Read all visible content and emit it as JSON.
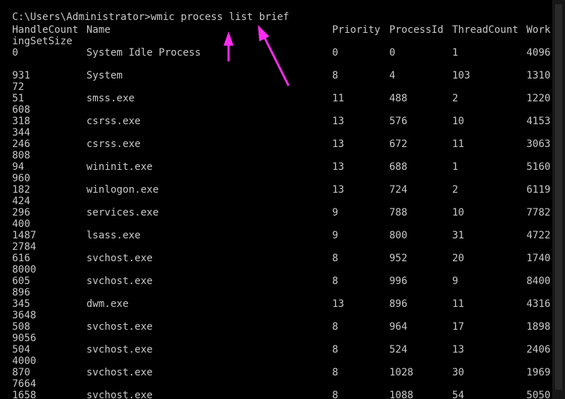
{
  "console": {
    "prompt": "C:\\Users\\Administrator>",
    "command": "wmic process list brief",
    "headers": {
      "handle": "HandleCount",
      "name": "Name",
      "priority": "Priority",
      "pid": "ProcessId",
      "threads": "ThreadCount",
      "work": "Work",
      "work_wrap": "ingSetSize"
    },
    "rows": [
      {
        "handle": "0",
        "name": "System Idle Process",
        "priority": "0",
        "pid": "0",
        "threads": "1",
        "work": "4096",
        "work_wrap": ""
      },
      {
        "handle": "931",
        "name": "System",
        "priority": "8",
        "pid": "4",
        "threads": "103",
        "work": "1310",
        "work_wrap": "72"
      },
      {
        "handle": "51",
        "name": "smss.exe",
        "priority": "11",
        "pid": "488",
        "threads": "2",
        "work": "1220",
        "work_wrap": "608"
      },
      {
        "handle": "318",
        "name": "csrss.exe",
        "priority": "13",
        "pid": "576",
        "threads": "10",
        "work": "4153",
        "work_wrap": "344"
      },
      {
        "handle": "246",
        "name": "csrss.exe",
        "priority": "13",
        "pid": "672",
        "threads": "11",
        "work": "3063",
        "work_wrap": "808"
      },
      {
        "handle": "94",
        "name": "wininit.exe",
        "priority": "13",
        "pid": "688",
        "threads": "1",
        "work": "5160",
        "work_wrap": "960"
      },
      {
        "handle": "182",
        "name": "winlogon.exe",
        "priority": "13",
        "pid": "724",
        "threads": "2",
        "work": "6119",
        "work_wrap": "424"
      },
      {
        "handle": "296",
        "name": "services.exe",
        "priority": "9",
        "pid": "788",
        "threads": "10",
        "work": "7782",
        "work_wrap": "400"
      },
      {
        "handle": "1487",
        "name": "lsass.exe",
        "priority": "9",
        "pid": "800",
        "threads": "31",
        "work": "4722",
        "work_wrap": "2784"
      },
      {
        "handle": "616",
        "name": "svchost.exe",
        "priority": "8",
        "pid": "952",
        "threads": "20",
        "work": "1740",
        "work_wrap": "8000"
      },
      {
        "handle": "605",
        "name": "svchost.exe",
        "priority": "8",
        "pid": "996",
        "threads": "9",
        "work": "8400",
        "work_wrap": "896"
      },
      {
        "handle": "345",
        "name": "dwm.exe",
        "priority": "13",
        "pid": "896",
        "threads": "11",
        "work": "4316",
        "work_wrap": "3648"
      },
      {
        "handle": "508",
        "name": "svchost.exe",
        "priority": "8",
        "pid": "964",
        "threads": "17",
        "work": "1898",
        "work_wrap": "9056"
      },
      {
        "handle": "504",
        "name": "svchost.exe",
        "priority": "8",
        "pid": "524",
        "threads": "13",
        "work": "2406",
        "work_wrap": "4000"
      },
      {
        "handle": "870",
        "name": "svchost.exe",
        "priority": "8",
        "pid": "1028",
        "threads": "30",
        "work": "1969",
        "work_wrap": "7664"
      },
      {
        "handle": "1658",
        "name": "svchost.exe",
        "priority": "8",
        "pid": "1088",
        "threads": "54",
        "work": "5050",
        "work_wrap": ""
      }
    ]
  },
  "annotations": {
    "arrow_color": "#ff2bf0"
  }
}
